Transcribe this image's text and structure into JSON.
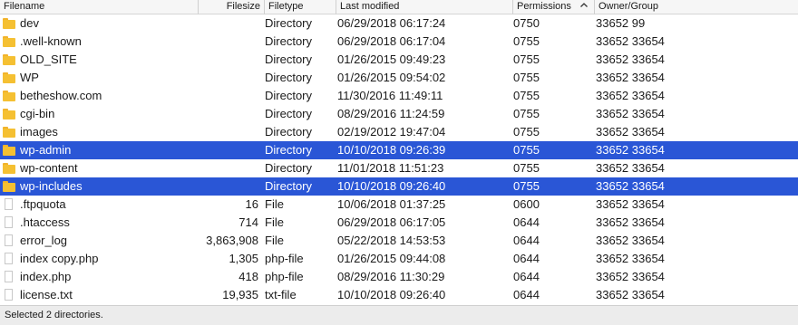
{
  "columns": {
    "filename": "Filename",
    "filesize": "Filesize",
    "filetype": "Filetype",
    "last_modified": "Last modified",
    "permissions": "Permissions",
    "owner_group": "Owner/Group"
  },
  "sort": {
    "column": "permissions",
    "direction": "ascending",
    "icon": "chevron-up-icon"
  },
  "files": [
    {
      "name": "dev",
      "size": "",
      "type": "Directory",
      "modified": "06/29/2018 06:17:24",
      "permissions": "0750",
      "owner": "33652 99",
      "icon": "folder-icon",
      "selected": false
    },
    {
      "name": ".well-known",
      "size": "",
      "type": "Directory",
      "modified": "06/29/2018 06:17:04",
      "permissions": "0755",
      "owner": "33652 33654",
      "icon": "folder-icon",
      "selected": false
    },
    {
      "name": "OLD_SITE",
      "size": "",
      "type": "Directory",
      "modified": "01/26/2015 09:49:23",
      "permissions": "0755",
      "owner": "33652 33654",
      "icon": "folder-icon",
      "selected": false
    },
    {
      "name": "WP",
      "size": "",
      "type": "Directory",
      "modified": "01/26/2015 09:54:02",
      "permissions": "0755",
      "owner": "33652 33654",
      "icon": "folder-icon",
      "selected": false
    },
    {
      "name": "betheshow.com",
      "size": "",
      "type": "Directory",
      "modified": "11/30/2016 11:49:11",
      "permissions": "0755",
      "owner": "33652 33654",
      "icon": "folder-icon",
      "selected": false
    },
    {
      "name": "cgi-bin",
      "size": "",
      "type": "Directory",
      "modified": "08/29/2016 11:24:59",
      "permissions": "0755",
      "owner": "33652 33654",
      "icon": "folder-icon",
      "selected": false
    },
    {
      "name": "images",
      "size": "",
      "type": "Directory",
      "modified": "02/19/2012 19:47:04",
      "permissions": "0755",
      "owner": "33652 33654",
      "icon": "folder-icon",
      "selected": false
    },
    {
      "name": "wp-admin",
      "size": "",
      "type": "Directory",
      "modified": "10/10/2018 09:26:39",
      "permissions": "0755",
      "owner": "33652 33654",
      "icon": "folder-icon",
      "selected": true
    },
    {
      "name": "wp-content",
      "size": "",
      "type": "Directory",
      "modified": "11/01/2018 11:51:23",
      "permissions": "0755",
      "owner": "33652 33654",
      "icon": "folder-icon",
      "selected": false
    },
    {
      "name": "wp-includes",
      "size": "",
      "type": "Directory",
      "modified": "10/10/2018 09:26:40",
      "permissions": "0755",
      "owner": "33652 33654",
      "icon": "folder-icon",
      "selected": true
    },
    {
      "name": ".ftpquota",
      "size": "16",
      "type": "File",
      "modified": "10/06/2018 01:37:25",
      "permissions": "0600",
      "owner": "33652 33654",
      "icon": "file-icon",
      "selected": false
    },
    {
      "name": ".htaccess",
      "size": "714",
      "type": "File",
      "modified": "06/29/2018 06:17:05",
      "permissions": "0644",
      "owner": "33652 33654",
      "icon": "file-icon",
      "selected": false
    },
    {
      "name": "error_log",
      "size": "3,863,908",
      "type": "File",
      "modified": "05/22/2018 14:53:53",
      "permissions": "0644",
      "owner": "33652 33654",
      "icon": "file-icon",
      "selected": false
    },
    {
      "name": "index copy.php",
      "size": "1,305",
      "type": "php-file",
      "modified": "01/26/2015 09:44:08",
      "permissions": "0644",
      "owner": "33652 33654",
      "icon": "file-icon",
      "selected": false
    },
    {
      "name": "index.php",
      "size": "418",
      "type": "php-file",
      "modified": "08/29/2016 11:30:29",
      "permissions": "0644",
      "owner": "33652 33654",
      "icon": "file-icon",
      "selected": false
    },
    {
      "name": "license.txt",
      "size": "19,935",
      "type": "txt-file",
      "modified": "10/10/2018 09:26:40",
      "permissions": "0644",
      "owner": "33652 33654",
      "icon": "file-icon",
      "selected": false
    }
  ],
  "status": {
    "text": "Selected 2 directories."
  },
  "colors": {
    "selection": "#2a56d6",
    "folder": "#f5c032",
    "header_bg": "#f6f6f6",
    "status_bg": "#ececec"
  }
}
